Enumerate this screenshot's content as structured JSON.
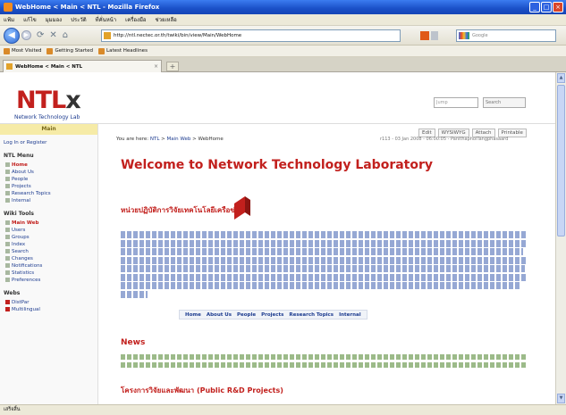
{
  "window": {
    "title": "WebHome < Main < NTL - Mozilla Firefox",
    "controls": [
      "_",
      "□",
      "×"
    ]
  },
  "menu": [
    "แฟ้ม",
    "แก้ไข",
    "มุมมอง",
    "ประวัติ",
    "ที่คั่นหน้า",
    "เครื่องมือ",
    "ช่วยเหลือ"
  ],
  "toolbar": {
    "url": "http://ntl.nectec.or.th/twiki/bin/view/Main/WebHome",
    "search_placeholder": "Google"
  },
  "bookmarks": [
    "Most Visited",
    "Getting Started",
    "Latest Headlines"
  ],
  "tab": {
    "label": "WebHome < Main < NTL"
  },
  "site": {
    "logo": "NTL",
    "logo_mark": "x",
    "logo_sub": "Network Technology Lab",
    "search_placeholder": "Jump",
    "search_btn": "Search",
    "edit_links": [
      "Edit",
      "WYSIWYG",
      "Attach",
      "Printable"
    ]
  },
  "sidebar": {
    "header": "Main",
    "login": "Log In or Register",
    "ntl_title": "NTL Menu",
    "ntl_items": [
      "Home",
      "About Us",
      "People",
      "Projects",
      "Research Topics",
      "Internal"
    ],
    "wiki_title": "Wiki Tools",
    "wiki_items": [
      "Main Web",
      "Users",
      "Groups",
      "Index",
      "Search",
      "Changes",
      "Notifications",
      "Statistics",
      "Preferences"
    ],
    "webs_title": "Webs",
    "webs_items": [
      "DistPar",
      "Multilingual"
    ]
  },
  "content": {
    "breadcrumb_prefix": "You are here:",
    "breadcrumb": [
      "NTL",
      "Main Web",
      "WebHome"
    ],
    "revision": "r113 - 03 Jan 2008 - 06:00:05 - PanithapholTangphasaard",
    "title": "Welcome to Network Technology Laboratory",
    "thai_heading": "หน่วยปฏิบัติการวิจัยเทคโนโลยีเครือข่าย",
    "tags": [
      "Home",
      "About Us",
      "People",
      "Projects",
      "Research Topics",
      "Internal"
    ],
    "news_heading": "News",
    "projects_heading": "โครงการวิจัยและพัฒนา (Public R&D Projects)"
  },
  "status": {
    "text": "เสร็จสิ้น"
  },
  "colors": {
    "accent": "#c2201d",
    "link": "#1c3b8f",
    "titlebar": "#1a50c8"
  }
}
